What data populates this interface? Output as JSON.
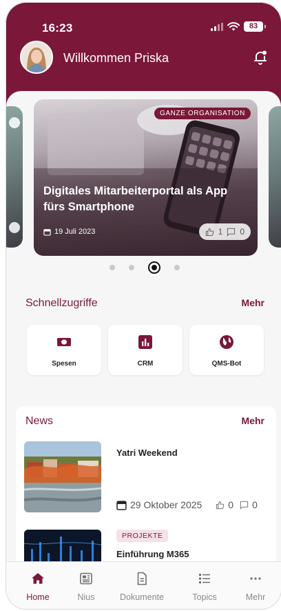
{
  "status_bar": {
    "time": "16:23",
    "battery": "83"
  },
  "header": {
    "welcome": "Willkommen Priska"
  },
  "carousel": {
    "card": {
      "badge": "GANZE ORGANISATION",
      "title": "Digitales Mitarbeiterportal als App fürs Smartphone",
      "date": "19 Juli 2023",
      "likes": "1",
      "comments": "0"
    },
    "page_count": 4,
    "active_index": 2
  },
  "quick_access": {
    "title": "Schnellzugriffe",
    "more": "Mehr",
    "items": [
      {
        "label": "Spesen",
        "icon": "money-icon"
      },
      {
        "label": "CRM",
        "icon": "bar-chart-icon"
      },
      {
        "label": "QMS-Bot",
        "icon": "globe-icon"
      }
    ]
  },
  "news": {
    "title": "News",
    "more": "Mehr",
    "items": [
      {
        "title": "Yatri Weekend",
        "date": "29 Oktober 2025",
        "likes": "0",
        "comments": "0"
      },
      {
        "tag": "PROJEKTE",
        "title": "Einführung M365"
      }
    ]
  },
  "tabbar": {
    "items": [
      {
        "label": "Home",
        "icon": "home-icon",
        "active": true
      },
      {
        "label": "Nius",
        "icon": "newspaper-icon"
      },
      {
        "label": "Dokumente",
        "icon": "document-icon"
      },
      {
        "label": "Topics",
        "icon": "list-icon"
      },
      {
        "label": "Mehr",
        "icon": "more-icon"
      }
    ]
  },
  "colors": {
    "brand": "#7b1738",
    "background": "#f6f6f7",
    "tag_bg": "#f5e1e7"
  }
}
